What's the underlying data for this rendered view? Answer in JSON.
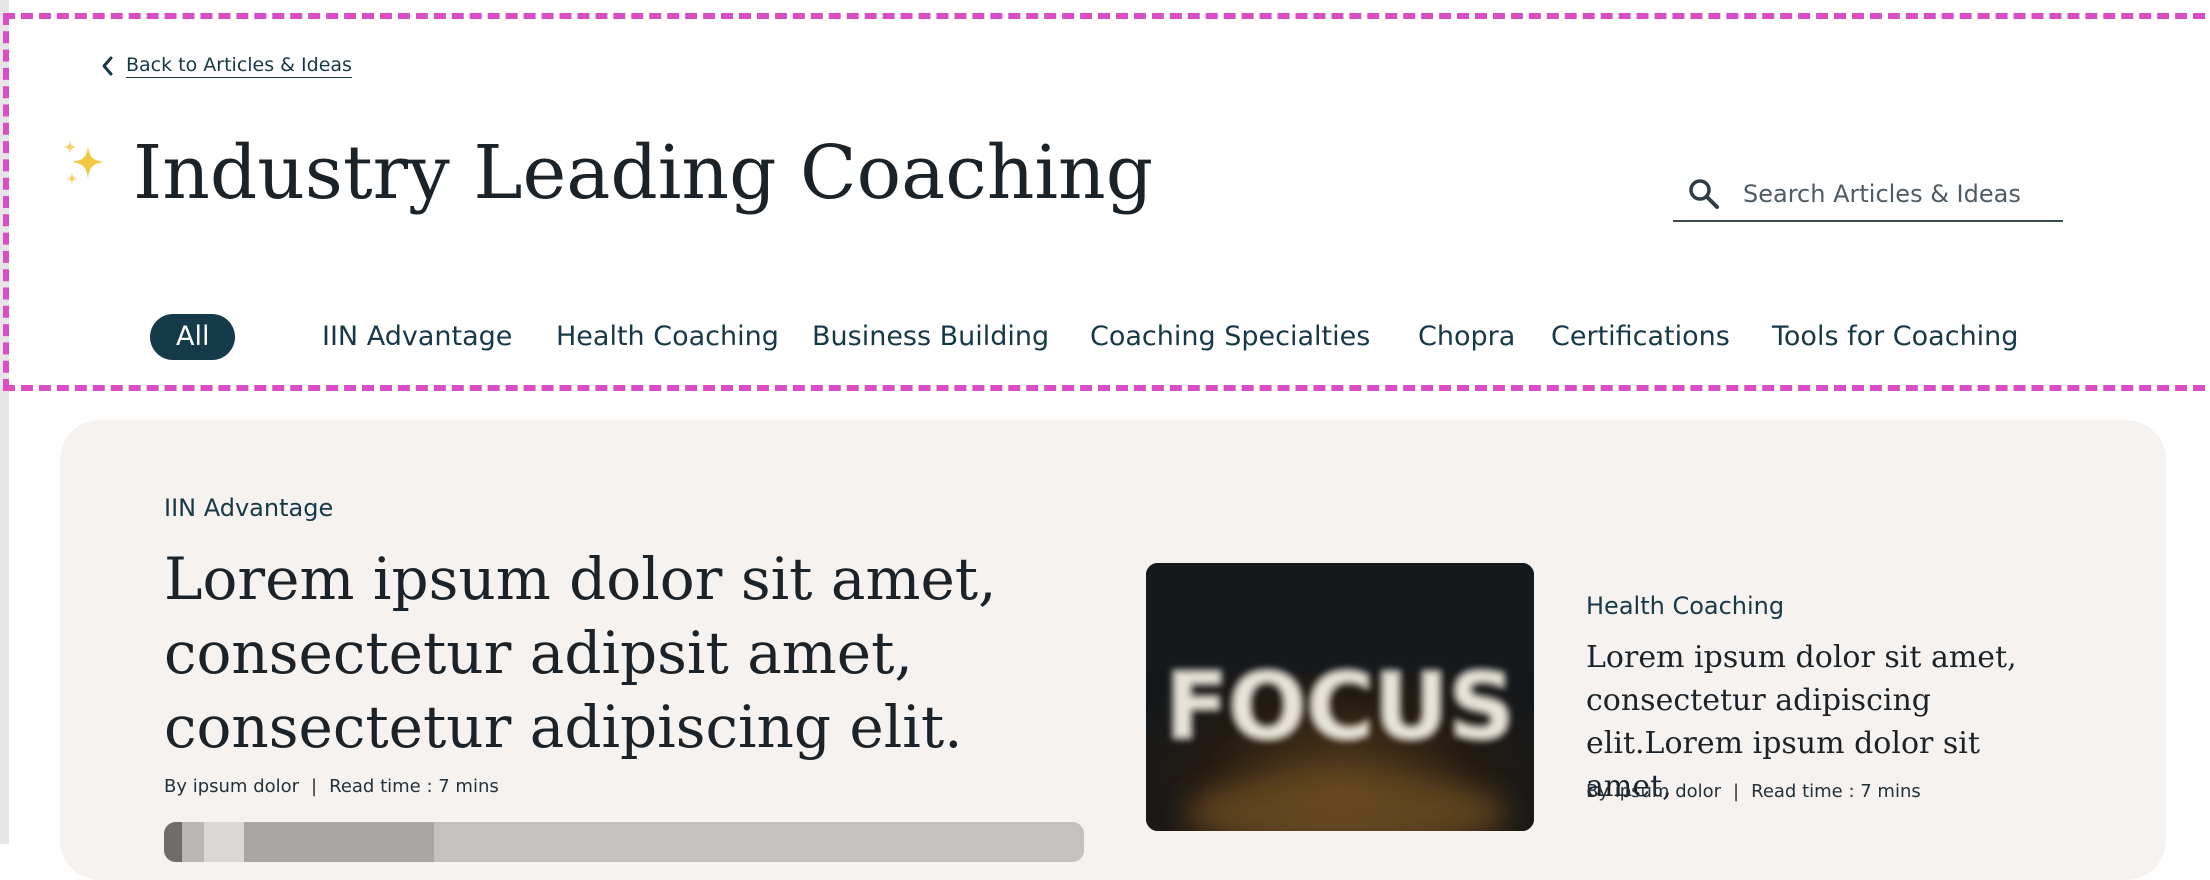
{
  "back_link": {
    "label": "Back to Articles & Ideas"
  },
  "header": {
    "title": "Industry Leading Coaching",
    "sparkle_icon": "sparkles-icon"
  },
  "search": {
    "placeholder": "Search Articles & Ideas",
    "value": "",
    "icon": "search-icon"
  },
  "tabs": [
    {
      "label": "All",
      "active": true
    },
    {
      "label": "IIN Advantage",
      "active": false
    },
    {
      "label": "Health Coaching",
      "active": false
    },
    {
      "label": "Business Building",
      "active": false
    },
    {
      "label": "Coaching Specialties",
      "active": false
    },
    {
      "label": "Chopra",
      "active": false
    },
    {
      "label": "Certifications",
      "active": false
    },
    {
      "label": "Tools for Coaching",
      "active": false
    }
  ],
  "featured": {
    "category": "IIN Advantage",
    "title": "Lorem ipsum dolor sit amet, consectetur adipsit amet, consectetur adipiscing elit.",
    "author": "By ipsum dolor",
    "separator": "|",
    "read_time": "Read time : 7 mins"
  },
  "side_article": {
    "category": "Health Coaching",
    "title": "Lorem ipsum dolor sit amet, consectetur adipiscing elit.Lorem ipsum dolor sit amet,",
    "author": "By ipsum dolor",
    "separator": "|",
    "read_time": "Read time : 7 mins",
    "image_text": "FOCUS"
  },
  "colors": {
    "accent": "#153b4a",
    "highlight_dash": "#d94fc3",
    "card_bg": "#f5f2ef"
  }
}
